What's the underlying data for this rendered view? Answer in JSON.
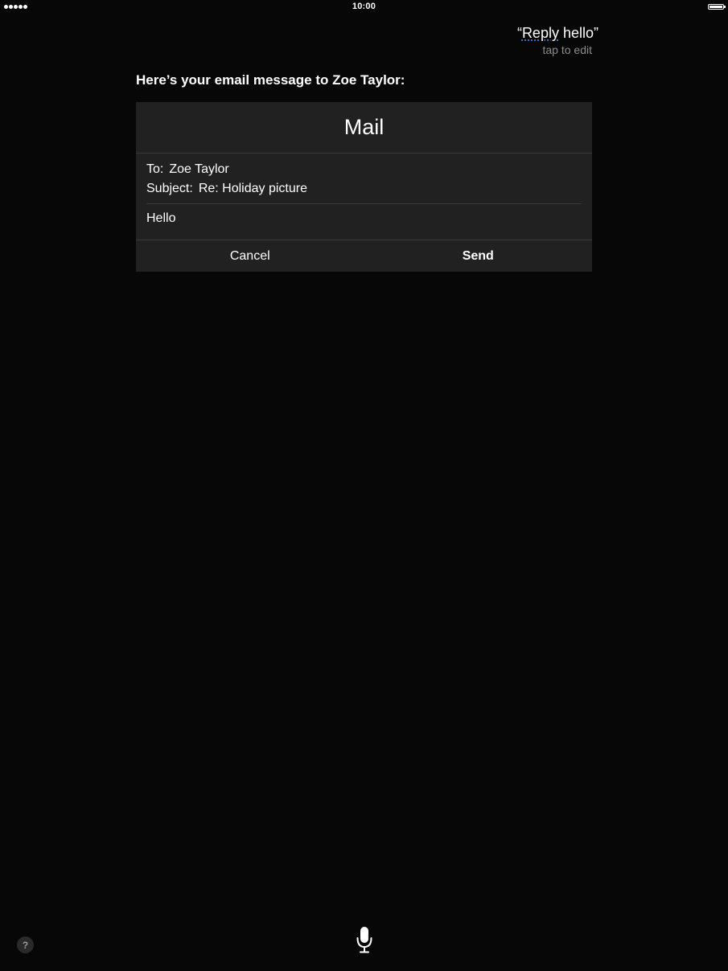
{
  "status_bar": {
    "time": "10:00",
    "signal_icon": "signal-dots-icon",
    "battery_icon": "battery-full-icon"
  },
  "siri": {
    "utterance_open_quote": "“",
    "utterance_flagged_word": "Reply",
    "utterance_rest": " hello”",
    "tap_to_edit": "tap to edit",
    "response": "Here’s your email message to Zoe Taylor:"
  },
  "mail_card": {
    "title": "Mail",
    "to_label": "To:",
    "to_value": "Zoe Taylor",
    "subject_label": "Subject:",
    "subject_value": "Re: Holiday picture",
    "body": "Hello",
    "cancel_label": "Cancel",
    "send_label": "Send"
  },
  "controls": {
    "help_label": "?",
    "help_icon": "help-icon",
    "mic_icon": "microphone-icon"
  },
  "colors": {
    "background": "#070707",
    "card": "#212121",
    "secondary_text": "#8c8c8c",
    "underline_accent": "#3d7bd9"
  }
}
